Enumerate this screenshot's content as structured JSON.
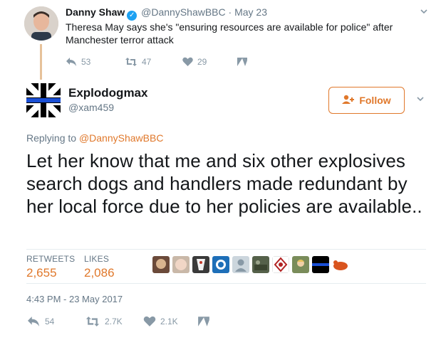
{
  "parent": {
    "name": "Danny Shaw",
    "handle": "@DannyShawBBC",
    "date": "May 23",
    "text": "Theresa May says she's \"ensuring resources are available for police\" after Manchester terror attack",
    "actions": {
      "reply_count": "53",
      "retweet_count": "47",
      "like_count": "29"
    }
  },
  "main": {
    "name": "Explodogmax",
    "handle": "@xam459",
    "follow_label": "Follow",
    "replying_prefix": "Replying to",
    "replying_to": "@DannyShawBBC",
    "text": "Let her know that me and six other explosives search dogs and handlers made redundant by her local force due to her policies are available..",
    "stats": {
      "retweets_label": "RETWEETS",
      "retweets_value": "2,655",
      "likes_label": "LIKES",
      "likes_value": "2,086"
    },
    "timestamp": "4:43 PM - 23 May 2017",
    "actions": {
      "reply_count": "54",
      "retweet_count": "2.7K",
      "like_count": "2.1K"
    }
  },
  "colors": {
    "accent": "#e0782b",
    "verified": "#1da1f2",
    "muted": "#657786",
    "icon": "#8899a6",
    "thread_line": "#e6c29a"
  },
  "icons": [
    "verified-icon",
    "chevron-down-icon",
    "reply-icon",
    "retweet-icon",
    "heart-icon",
    "message-icon",
    "follow-person-icon"
  ]
}
